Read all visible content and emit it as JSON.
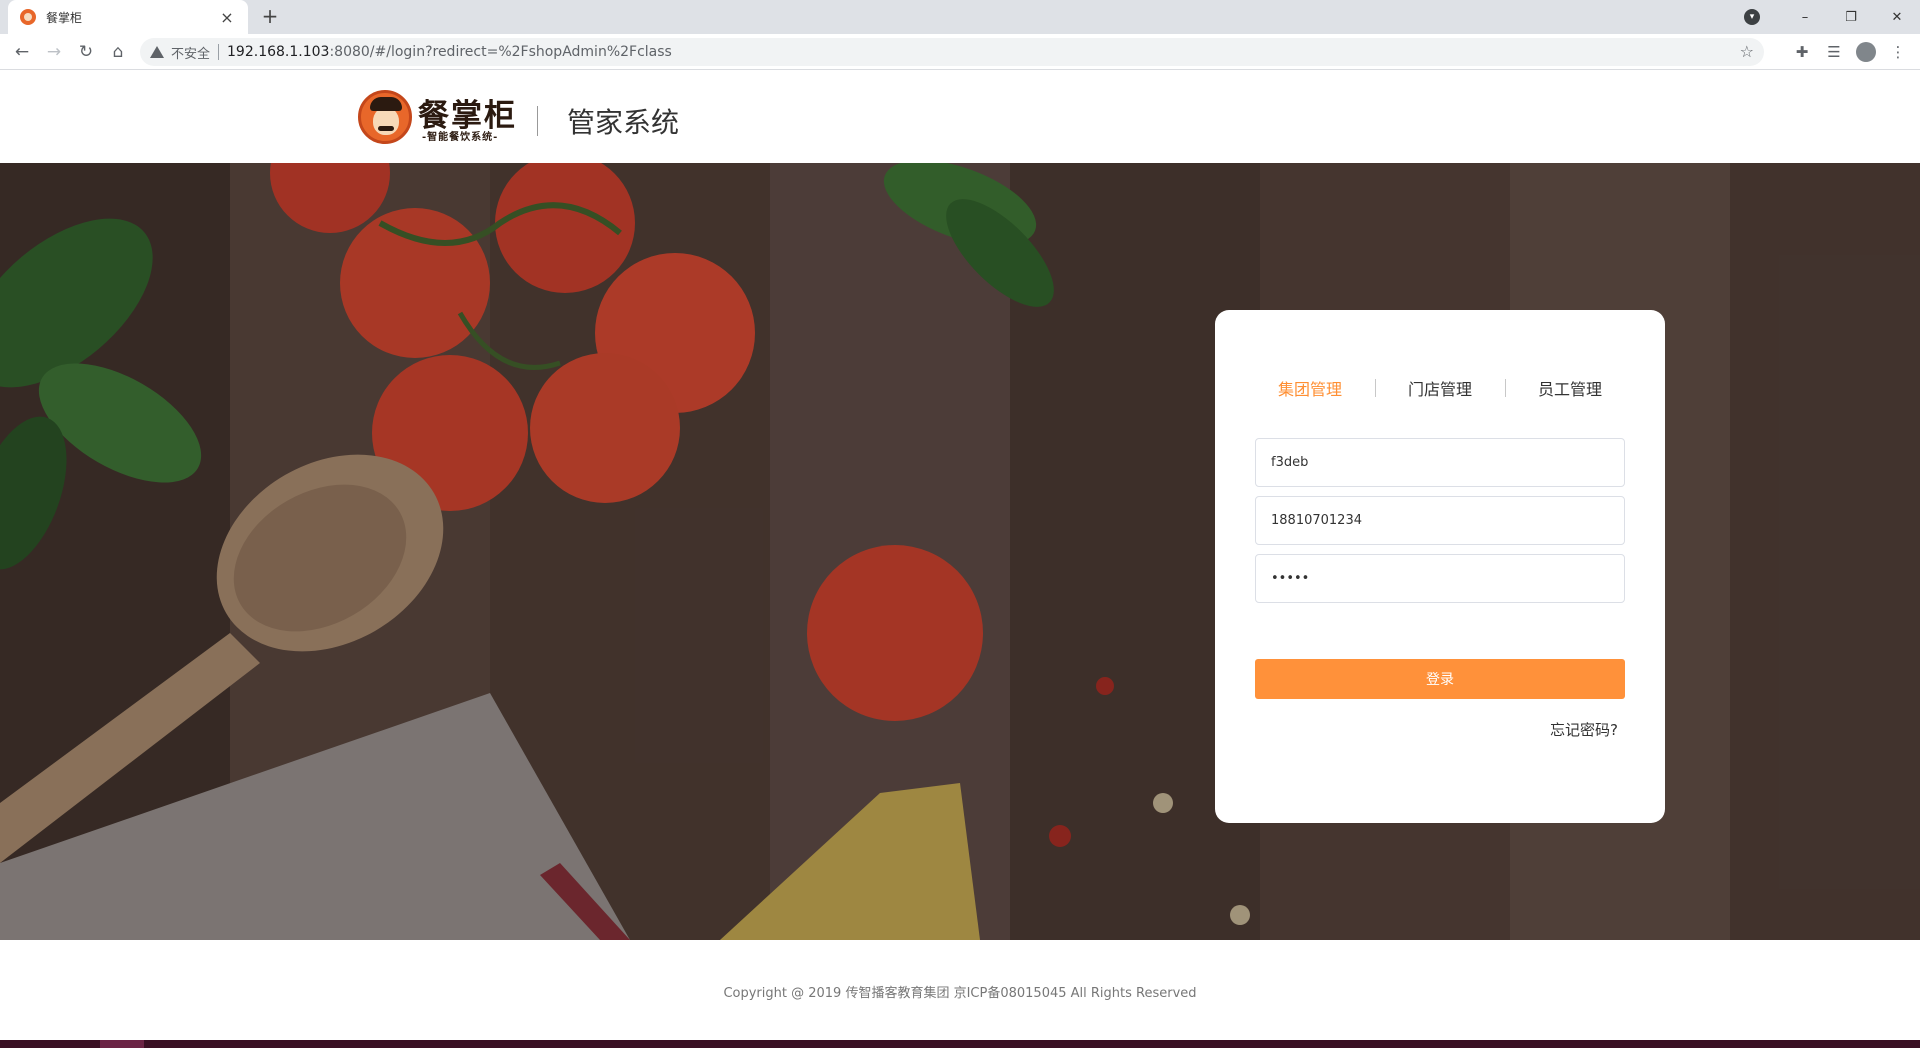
{
  "browser": {
    "tab_title": "餐掌柜",
    "tab_close": "×",
    "new_tab": "+",
    "insecure_label": "不安全",
    "url_host": "192.168.1.103",
    "url_rest": ":8080/#/login?redirect=%2FshopAdmin%2Fclass",
    "window_controls": {
      "minimize": "–",
      "maximize": "❐",
      "close": "✕"
    }
  },
  "header": {
    "logo_name": "餐掌柜",
    "logo_tagline": "-智能餐饮系统-",
    "system_title": "管家系统"
  },
  "login": {
    "tabs": [
      {
        "label": "集团管理",
        "active": true
      },
      {
        "label": "门店管理",
        "active": false
      },
      {
        "label": "员工管理",
        "active": false
      }
    ],
    "account_value": "f3deb",
    "phone_value": "18810701234",
    "password_value": "•••••",
    "submit_label": "登录",
    "forgot_label": "忘记密码?",
    "accent_color": "#ff913a"
  },
  "footer": {
    "copyright": "Copyright @ 2019 传智播客教育集团 京ICP备08015045 All Rights Reserved"
  }
}
